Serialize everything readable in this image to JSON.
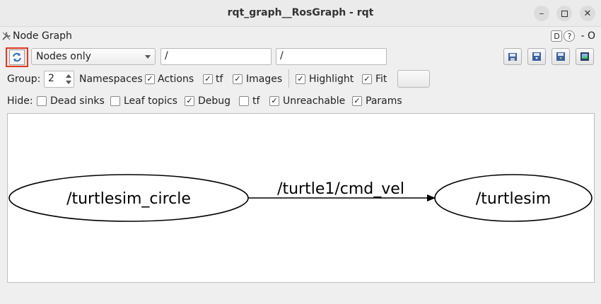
{
  "window": {
    "title": "rqt_graph__RosGraph - rqt"
  },
  "plugin": {
    "title": "Node Graph",
    "help_label": "D",
    "help_q": "?",
    "close_label": "- O"
  },
  "toolbar": {
    "mode_selected": "Nodes only",
    "ns_filter": "/",
    "topic_filter": "/"
  },
  "options": {
    "group_label": "Group:",
    "group_value": "2",
    "items": [
      {
        "label": "Namespaces",
        "checked": true
      },
      {
        "label": "Actions",
        "checked": true
      },
      {
        "label": "tf",
        "checked": true
      },
      {
        "label": "Images",
        "checked": true
      },
      {
        "label": "Highlight",
        "checked": true
      },
      {
        "label": "Fit",
        "checked": true
      }
    ]
  },
  "hide": {
    "label": "Hide:",
    "items": [
      {
        "label": "Dead sinks",
        "checked": false
      },
      {
        "label": "Leaf topics",
        "checked": false
      },
      {
        "label": "Debug",
        "checked": true
      },
      {
        "label": "tf",
        "checked": false
      },
      {
        "label": "Unreachable",
        "checked": true
      },
      {
        "label": "Params",
        "checked": true
      }
    ]
  },
  "graph": {
    "nodes": [
      {
        "id": "turtlesim_circle",
        "label": "/turtlesim_circle"
      },
      {
        "id": "turtlesim",
        "label": "/turtlesim"
      }
    ],
    "edges": [
      {
        "from": "turtlesim_circle",
        "to": "turtlesim",
        "label": "/turtle1/cmd_vel"
      }
    ]
  },
  "colors": {
    "highlight_border": "#e23a1f",
    "check_mark": "#111111"
  }
}
